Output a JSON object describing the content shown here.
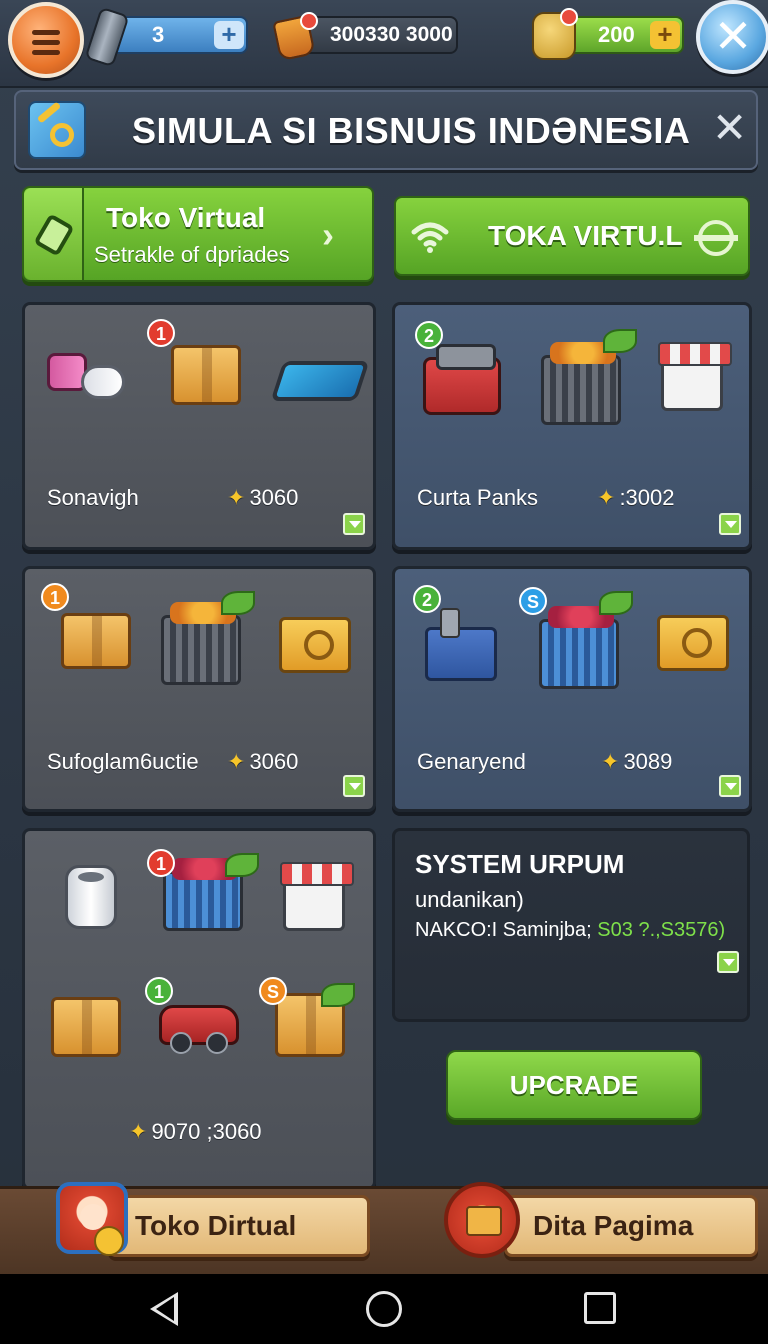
{
  "topbar": {
    "battery_value": "3",
    "coins_value": "300330 3000",
    "gold_value": "200",
    "icons": [
      "menu-icon",
      "battery-icon",
      "bag-icon",
      "gold-icon",
      "close-icon"
    ]
  },
  "title": {
    "text": "SIMULA SI BISNUIS INDƏNESIA"
  },
  "tabs": {
    "left": {
      "title": "Toko Virtual",
      "subtitle": "Setrakle of dpriades"
    },
    "right": {
      "label": "TOKA VIRTU.L"
    }
  },
  "cards": [
    {
      "name": "Sonavigh",
      "price": "3060",
      "badge": "1"
    },
    {
      "name": "Curta Panks",
      "price": ":3002",
      "badge": "2"
    },
    {
      "name": "Sufoglam6uctie",
      "price": "3060",
      "badge": "1"
    },
    {
      "name": "Genaryend",
      "price": "3089",
      "badge": "2",
      "badge2": "S"
    }
  ],
  "bigcard": {
    "price": "9070 ;3060",
    "badges": [
      "1",
      "1",
      "S"
    ]
  },
  "system": {
    "title": "SYSTEM URPUM",
    "subtitle": "undanikan)",
    "detail_label": "NAKCO:I Saminjba;",
    "detail_value": "S03 ?.,S3576)"
  },
  "upgrade": {
    "label": "UPCRADE"
  },
  "bottombar": {
    "left_label": "Toko Dirtual",
    "right_label": "Dita Pagima"
  },
  "colors": {
    "accent_green": "#6ab22e",
    "bar_brown": "#5a3e2b",
    "price_star": "#f6c52a"
  }
}
